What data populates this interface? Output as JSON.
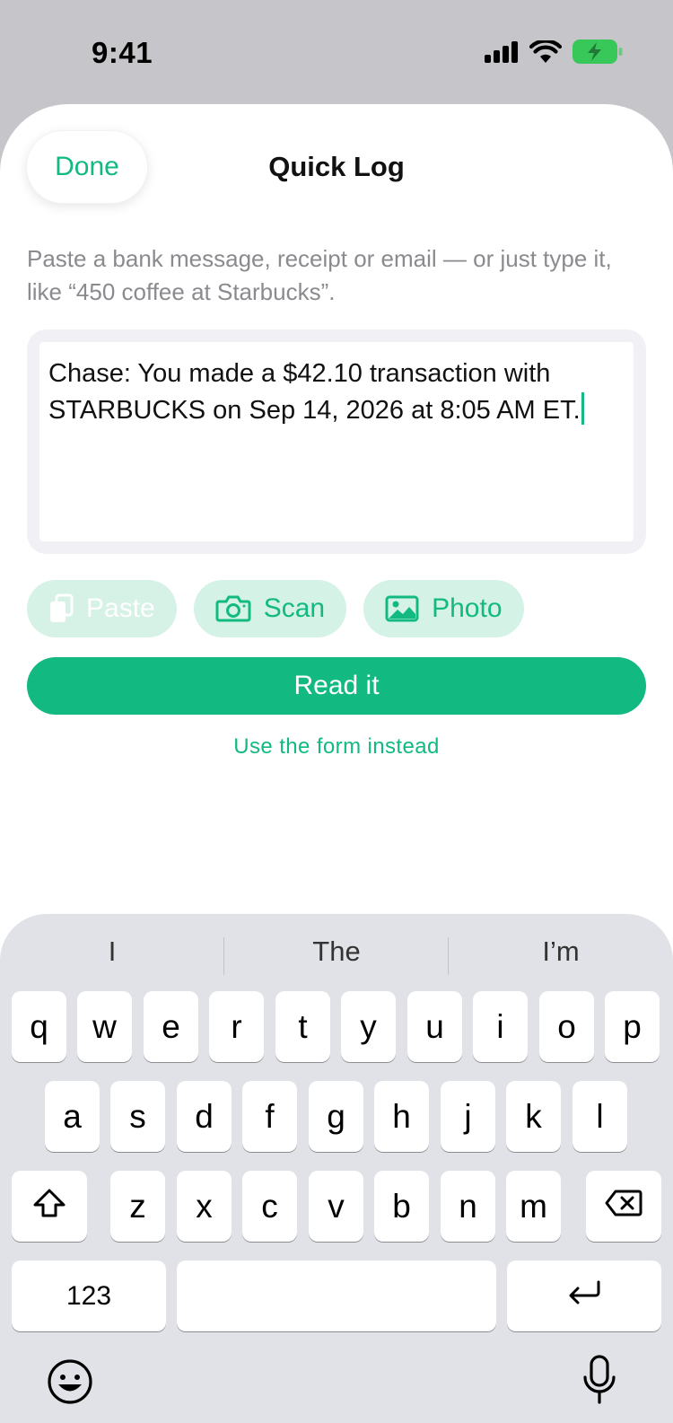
{
  "status": {
    "time": "9:41"
  },
  "sheet": {
    "done_label": "Done",
    "title": "Quick Log",
    "hint": "Paste a bank message, receipt or email — or just type it, like “450 coffee at Starbucks”.",
    "input_value": "Chase: You made a $42.10 transaction with STARBUCKS on Sep 14, 2026 at 8:05 AM ET.",
    "chips": [
      {
        "label": "Paste",
        "icon": "paste-icon",
        "enabled": false
      },
      {
        "label": "Scan",
        "icon": "camera-icon",
        "enabled": true
      },
      {
        "label": "Photo",
        "icon": "photo-icon",
        "enabled": true
      }
    ],
    "read_label": "Read it",
    "form_link": "Use the form instead"
  },
  "keyboard": {
    "suggestions": [
      "I",
      "The",
      "I’m"
    ],
    "row1": [
      "q",
      "w",
      "e",
      "r",
      "t",
      "y",
      "u",
      "i",
      "o",
      "p"
    ],
    "row2": [
      "a",
      "s",
      "d",
      "f",
      "g",
      "h",
      "j",
      "k",
      "l"
    ],
    "row3": [
      "z",
      "x",
      "c",
      "v",
      "b",
      "n",
      "m"
    ],
    "numbers_label": "123"
  },
  "colors": {
    "accent": "#12b981",
    "chip_bg": "#d4f2e6",
    "keyboard_bg": "#e1e2e7"
  }
}
